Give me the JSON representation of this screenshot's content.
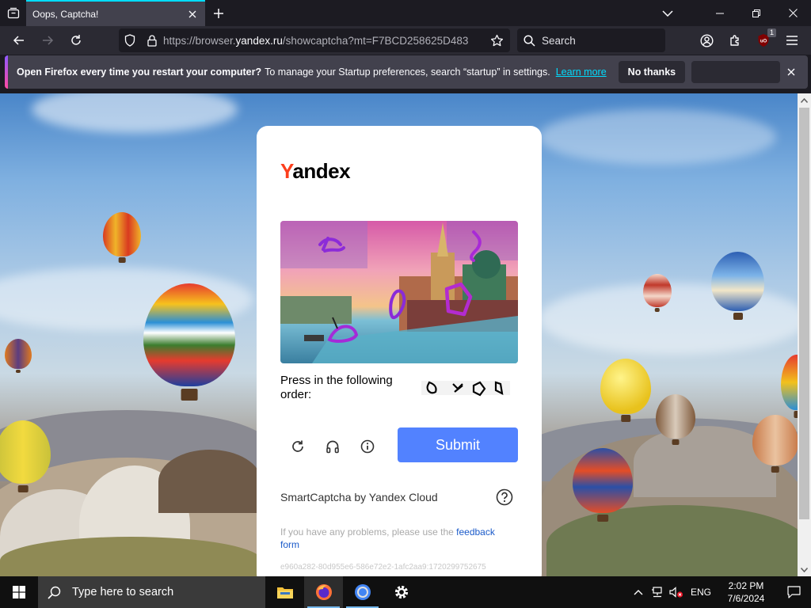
{
  "browser": {
    "tab": {
      "title": "Oops, Captcha!"
    },
    "url": {
      "prefix": "https://browser.",
      "domain": "yandex.ru",
      "suffix": "/showcaptcha?mt=F7BCD258625D483"
    },
    "search": {
      "placeholder": "Search"
    },
    "extension_badge": "1"
  },
  "notification": {
    "strong_text": "Open Firefox every time you restart your computer?",
    "text": "To manage your Startup preferences, search “startup” in settings.",
    "link": "Learn more",
    "dismiss_button": "No thanks",
    "accept_button": ""
  },
  "captcha": {
    "logo_first_letter": "Y",
    "logo_rest": "andex",
    "instruction": "Press in the following order:",
    "submit": "Submit",
    "branding": "SmartCaptcha by Yandex Cloud",
    "problems_text": "If you have any problems, please use the",
    "feedback_link": "feedback form",
    "request_id": "e960a282-80d955e6-586e72e2-1afc2aa9:1720299752675",
    "colors": {
      "submit": "#5282ff",
      "logo_accent": "#fc3f1d",
      "link": "#1a5ac9"
    }
  },
  "taskbar": {
    "search_placeholder": "Type here to search",
    "language": "ENG",
    "time": "2:02 PM",
    "date": "7/6/2024",
    "apps": [
      "file-explorer",
      "firefox",
      "chrome",
      "settings"
    ]
  }
}
